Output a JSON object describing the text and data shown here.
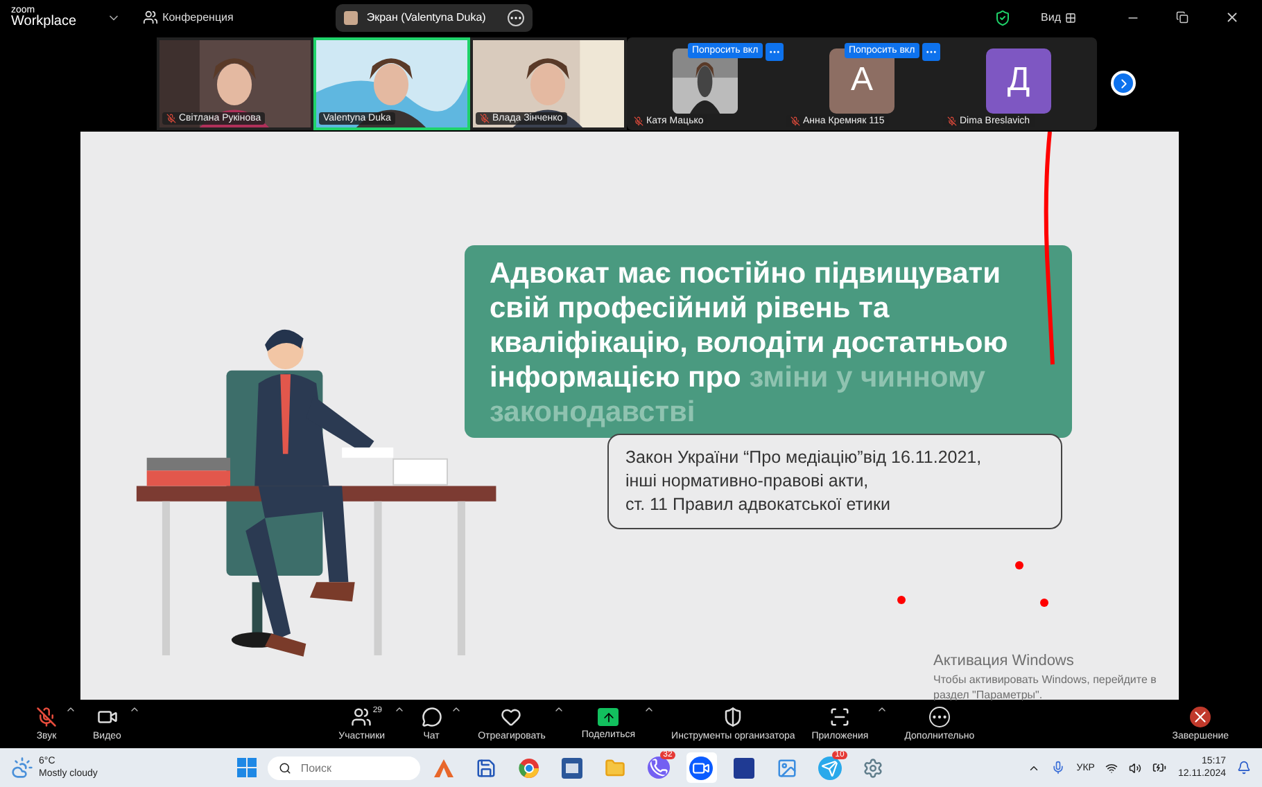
{
  "top_bar": {
    "logo_small": "zoom",
    "logo_big": "Workplace",
    "meeting": "Конференция",
    "share_pill": "Экран (Valentyna Duka)",
    "view": "Вид"
  },
  "participants": [
    {
      "name": "Світлана Рукінова",
      "kind": "video",
      "muted": true,
      "speaking": false
    },
    {
      "name": "Valentyna Duka",
      "kind": "video",
      "muted": false,
      "speaking": true
    },
    {
      "name": "Влада Зінченко",
      "kind": "video",
      "muted": true,
      "speaking": false
    },
    {
      "name": "Катя Мацько",
      "muted": true,
      "ask_button": "Попросить вкл"
    },
    {
      "name": "Анна Кремняк 115",
      "kind": "avatar",
      "initial": "А",
      "color": "#8d6e63",
      "muted": true,
      "ask_button": "Попросить вкл"
    },
    {
      "name": "Dima Breslavich",
      "kind": "avatar",
      "initial": "Д",
      "color": "#7e57c2",
      "muted": true
    }
  ],
  "slide": {
    "heading": [
      {
        "text": "Адвокат має постійно підвищувати свій професійний рівень та кваліфікацію, володіти достатньою інформацією про",
        "accent": false
      },
      {
        "text": "зміни у чинному законодавстві",
        "accent": true
      }
    ],
    "note": [
      "Закон України “Про медіацію”від 16.11.2021,",
      "інші нормативно-правові акти,",
      "ст. 11 Правил адвокатської етики"
    ]
  },
  "activation": {
    "title": "Активация Windows",
    "text": "Чтобы активировать Windows, перейдите в раздел \"Параметры\"."
  },
  "toolbar": [
    {
      "kind": "mic",
      "label": "Звук",
      "muted": true,
      "caret": true
    },
    {
      "kind": "video",
      "label": "Видео",
      "caret": true
    },
    {
      "kind": "spacer"
    },
    {
      "kind": "users",
      "label": "Участники",
      "count": "29",
      "caret": true
    },
    {
      "kind": "chat",
      "label": "Чат",
      "caret": true
    },
    {
      "kind": "heart",
      "label": "Отреагировать",
      "caret": true
    },
    {
      "kind": "share",
      "label": "Поделиться",
      "caret": true
    },
    {
      "kind": "shield",
      "label": "Инструменты организатора",
      "caret": false
    },
    {
      "kind": "apps",
      "label": "Приложения",
      "caret": true
    },
    {
      "kind": "more",
      "label": "Дополнительно",
      "caret": false
    },
    {
      "kind": "spacer"
    },
    {
      "kind": "end",
      "label": "Завершение",
      "caret": false
    }
  ],
  "taskbar": {
    "temperature": "6°C",
    "weather": "Mostly cloudy",
    "search_placeholder": "Поиск",
    "apps": [
      {
        "kind": "cone"
      },
      {
        "kind": "disk"
      },
      {
        "kind": "chrome"
      },
      {
        "kind": "word"
      },
      {
        "kind": "folder"
      },
      {
        "kind": "viber",
        "badge": "32"
      },
      {
        "kind": "zoom",
        "selected": true
      },
      {
        "kind": "letter"
      },
      {
        "kind": "photos"
      },
      {
        "kind": "telegram",
        "badge": "10"
      },
      {
        "kind": "gear"
      }
    ],
    "language": "УКР",
    "time": "15:17",
    "date": "12.11.2024"
  }
}
